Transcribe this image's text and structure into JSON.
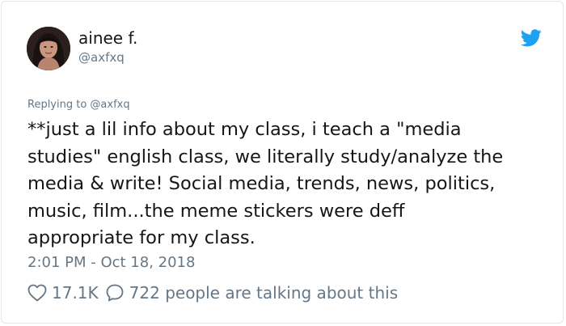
{
  "author": {
    "display_name": "ainee f.",
    "handle": "@axfxq",
    "avatar_icon": "user-avatar-photo"
  },
  "brand": {
    "icon": "twitter-bird-icon",
    "color": "#1da1f2"
  },
  "reply": {
    "text": "Replying to @axfxq"
  },
  "tweet": {
    "lines": [
      "**just a lil info about my class, i teach a \"media",
      "studies\" english class, we literally study/analyze the",
      "media & write! Social media, trends, news, politics,",
      "music, film...the meme stickers were deff",
      "appropriate for my class."
    ]
  },
  "meta": {
    "timestamp": "2:01 PM - Oct 18, 2018"
  },
  "actions": {
    "like_icon": "heart-icon",
    "like_count": "17.1K",
    "reply_icon": "speech-bubble-icon",
    "talking_text": "722 people are talking about this"
  },
  "colors": {
    "text_primary": "#14171a",
    "text_secondary": "#657786",
    "border": "#e1e8ed"
  }
}
